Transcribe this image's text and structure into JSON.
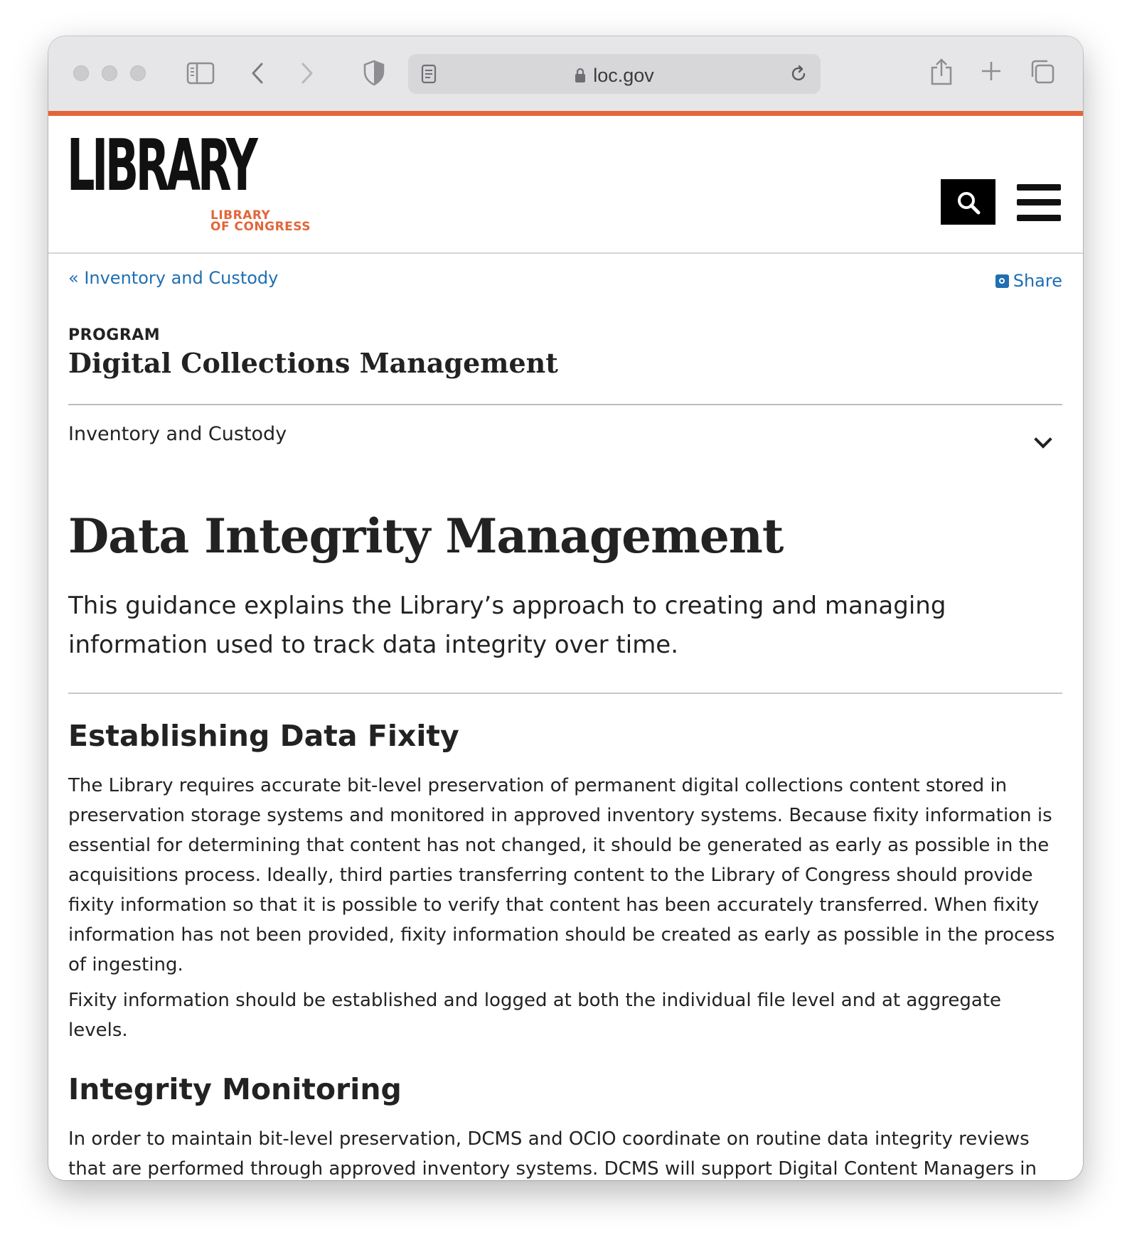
{
  "browser": {
    "url": "loc.gov"
  },
  "site": {
    "logo_word": "LIBRARY",
    "logo_sub_line1": "LIBRARY",
    "logo_sub_line2": "OF CONGRESS",
    "accent_color": "#e3653a",
    "link_color": "#1f6fb2"
  },
  "breadcrumb": {
    "back_link": "« Inventory and Custody",
    "share_label": "Share"
  },
  "program": {
    "label": "PROGRAM",
    "title": "Digital Collections Management"
  },
  "section_select": {
    "value": "Inventory and Custody"
  },
  "page": {
    "title": "Data Integrity Management",
    "intro": "This guidance explains the Library’s approach to creating and managing information used to track data integrity over time."
  },
  "sections": [
    {
      "heading": "Establishing Data Fixity",
      "paragraphs": [
        "The Library requires accurate bit-level preservation of permanent digital collections content stored in preservation storage systems and monitored in approved inventory systems. Because fixity information is essential for determining that content has not changed, it should be generated as early as possible in the acquisitions process. Ideally, third parties transferring content to the Library of Congress should provide fixity information so that it is possible to verify that content has been accurately transferred. When fixity information has not been provided, fixity information should be created as early as possible in the process of ingesting.",
        "Fixity information should be established and logged at both the individual file level and at aggregate levels."
      ]
    },
    {
      "heading": "Integrity Monitoring",
      "paragraphs": [
        "In order to maintain bit-level preservation, DCMS and OCIO coordinate on routine data integrity reviews that are performed through approved inventory systems. DCMS will support Digital Content Managers in identifying and resolving issues raised through reviews. The current priority is to conduct full routine"
      ]
    }
  ]
}
